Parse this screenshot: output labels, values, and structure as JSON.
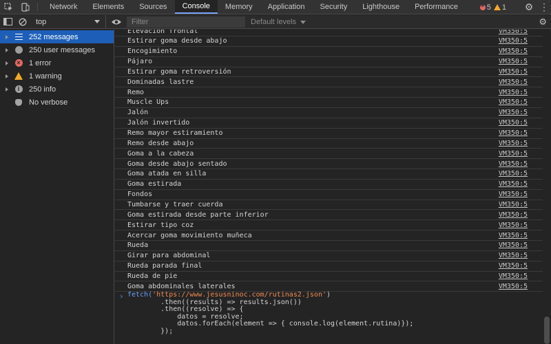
{
  "topbar": {
    "tabs": [
      "Network",
      "Elements",
      "Sources",
      "Console",
      "Memory",
      "Application",
      "Security",
      "Lighthouse",
      "Performance"
    ],
    "active_tab": "Console",
    "error_count": "5",
    "warning_count": "1"
  },
  "toolbar": {
    "context": "top",
    "filter_placeholder": "Filter",
    "levels_label": "Default levels"
  },
  "sidebar": {
    "items": [
      {
        "label": "252 messages",
        "icon": "list-icon"
      },
      {
        "label": "250 user messages",
        "icon": "user-icon"
      },
      {
        "label": "1 error",
        "icon": "error-icon"
      },
      {
        "label": "1 warning",
        "icon": "warning-icon"
      },
      {
        "label": "250 info",
        "icon": "info-icon"
      },
      {
        "label": "No verbose",
        "icon": "bug-icon"
      }
    ]
  },
  "console": {
    "source": "VM350:5",
    "logs": [
      "Elevación frontal",
      "Estirar goma desde abajo",
      "Encogimiento",
      "Pájaro",
      "Estirar goma retroversión",
      "Dominadas lastre",
      "Remo",
      "Muscle Ups",
      "Jalón",
      "Jalón invertido",
      "Remo mayor estiramiento",
      "Remo desde abajo",
      "Goma a la cabeza",
      "Goma desde abajo sentado",
      "Goma atada en silla",
      "Goma estirada",
      "Fondos",
      "Tumbarse y traer cuerda",
      "Goma estirada desde parte inferior",
      "Estirar tipo coz",
      "Acercar goma movimiento muñeca",
      "Rueda",
      "Girar para abdominal",
      "Rueda parada final",
      "Rueda de pie",
      "Goma abdominales laterales"
    ],
    "input_code": {
      "line1_fn": "fetch(",
      "line1_str": "'https://www.jesusninoc.com/rutinas2.json'",
      "line1_end": ")",
      "line2": "        .then((results) => results.json())",
      "line3": "        .then((resolve) => {",
      "line4": "            datos = resolve;",
      "line5": "            datos.forEach(element => { console.log(element.rutina)});",
      "line6": "        });"
    }
  },
  "colors": {
    "background": "#242424",
    "accent": "#1d5fb8",
    "error": "#e46962",
    "warning": "#f2ab26",
    "string": "#f28b54",
    "keyword": "#6ba1f7"
  }
}
